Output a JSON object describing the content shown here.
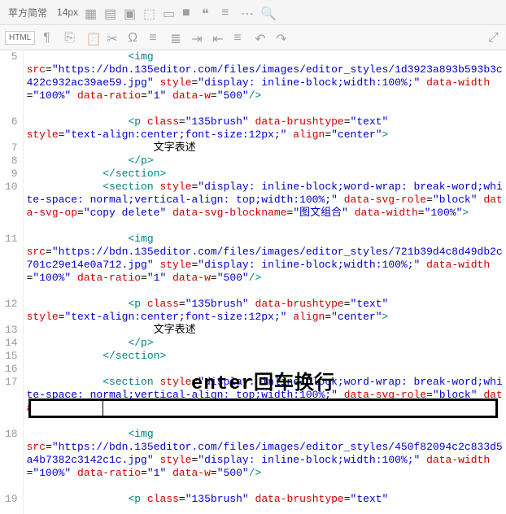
{
  "toolbar": {
    "font": "苹方简常",
    "fontsize": "14px",
    "htmlLabel": "HTML"
  },
  "overlay": {
    "text": "enter回车换行"
  },
  "lines": [
    {
      "num": "5",
      "h": "gh2",
      "ch": "ch80",
      "html": "                <span class='t'>&lt;img</span>\n<span class='an'>src</span>=<span class='av'>\"https://bdn.135editor.com/files/images/editor_styles/1d3923a893b593b3c422c932ac39ae59.jpg\"</span> <span class='an'>style</span>=<span class='av'>\"display: inline-block;width:100%;\"</span> <span class='an'>data-width</span>=<span class='av'>\"100%\"</span> <span class='an'>data-ratio</span>=<span class='av'>\"1\"</span> <span class='an'>data-w</span>=<span class='av'>\"500\"</span><span class='t'>/&gt;</span>"
    },
    {
      "num": "6",
      "h": "",
      "ch": "",
      "html": "                <span class='t'>&lt;p</span> <span class='an'>class</span>=<span class='av'>\"135brush\"</span> <span class='an'>data-brushtype</span>=<span class='av'>\"text\"</span>\n<span class='an'>style</span>=<span class='av'>\"text-align:center;font-size:12px;\"</span> <span class='an'>align</span>=<span class='av'>\"center\"</span><span class='t'>&gt;</span>"
    },
    {
      "num": "7",
      "h": "",
      "ch": "",
      "html": "                    <span class='tx'>文字表述</span>"
    },
    {
      "num": "8",
      "h": "",
      "ch": "",
      "html": "                <span class='t'>&lt;/p&gt;</span>"
    },
    {
      "num": "9",
      "h": "",
      "ch": "",
      "html": "            <span class='t'>&lt;/section&gt;</span>"
    },
    {
      "num": "10",
      "h": "gh",
      "ch": "ch64",
      "html": "            <span class='t'>&lt;section</span> <span class='an'>style</span>=<span class='av'>\"display: inline-block;word-wrap: break-word;white-space: normal;vertical-align: top;width:100%;\"</span> <span class='an'>data-svg-role</span>=<span class='av'>\"block\"</span> <span class='an'>data-svg-op</span>=<span class='av'>\"copy delete\"</span> <span class='an'>data-svg-blockname</span>=<span class='av'>\"图文组合\"</span> <span class='an'>data-width</span>=<span class='av'>\"100%\"</span><span class='t'>&gt;</span>"
    },
    {
      "num": "11",
      "h": "gh2",
      "ch": "ch80",
      "html": "                <span class='t'>&lt;img</span>\n<span class='an'>src</span>=<span class='av'>\"https://bdn.135editor.com/files/images/editor_styles/721b39d4c8d49db2c701c29e14e0a712.jpg\"</span> <span class='an'>style</span>=<span class='av'>\"display: inline-block;width:100%;\"</span> <span class='an'>data-width</span>=<span class='av'>\"100%\"</span> <span class='an'>data-ratio</span>=<span class='av'>\"1\"</span> <span class='an'>data-w</span>=<span class='av'>\"500\"</span><span class='t'>/&gt;</span>"
    },
    {
      "num": "12",
      "h": "",
      "ch": "",
      "html": "                <span class='t'>&lt;p</span> <span class='an'>class</span>=<span class='av'>\"135brush\"</span> <span class='an'>data-brushtype</span>=<span class='av'>\"text\"</span>\n<span class='an'>style</span>=<span class='av'>\"text-align:center;font-size:12px;\"</span> <span class='an'>align</span>=<span class='av'>\"center\"</span><span class='t'>&gt;</span>"
    },
    {
      "num": "13",
      "h": "",
      "ch": "",
      "html": "                    <span class='tx'>文字表述</span>"
    },
    {
      "num": "14",
      "h": "",
      "ch": "",
      "html": "                <span class='t'>&lt;/p&gt;</span>"
    },
    {
      "num": "15",
      "h": "",
      "ch": "",
      "html": "            <span class='t'>&lt;/section&gt;</span>"
    },
    {
      "num": "16",
      "h": "",
      "ch": "",
      "html": " "
    },
    {
      "num": "17",
      "h": "gh",
      "ch": "ch64",
      "html": "            <span class='t'>&lt;section</span> <span class='an'>style</span>=<span class='av'>\"display: inline-block;word-wrap: break-word;white-space: normal;vertical-align: top;width:100%;\"</span> <span class='an'>data-svg-role</span>=<span class='av'>\"block\"</span> <span class='an'>data-svg-op</span>=<span class='av'>\"copy delete\"</span> <span class='an'>data-svg-blockname</span>=<span class='av'>\"图文组合\"</span> <span class='an'>data-width</span>=<span class='av'>\"100%\"</span><span class='t'>&gt;</span>"
    },
    {
      "num": "18",
      "h": "gh2",
      "ch": "ch80",
      "html": "                <span class='t'>&lt;img</span>\n<span class='an'>src</span>=<span class='av'>\"https://bdn.135editor.com/files/images/editor_styles/450f82094c2c833d5a4b7382c3142c1c.jpg\"</span> <span class='an'>style</span>=<span class='av'>\"display: inline-block;width:100%;\"</span> <span class='an'>data-width</span>=<span class='av'>\"100%\"</span> <span class='an'>data-ratio</span>=<span class='av'>\"1\"</span> <span class='an'>data-w</span>=<span class='av'>\"500\"</span><span class='t'>/&gt;</span>"
    },
    {
      "num": "19",
      "h": "",
      "ch": "",
      "html": "                <span class='t'>&lt;p</span> <span class='an'>class</span>=<span class='av'>\"135brush\"</span> <span class='an'>data-brushtype</span>=<span class='av'>\"text\"</span>"
    }
  ]
}
